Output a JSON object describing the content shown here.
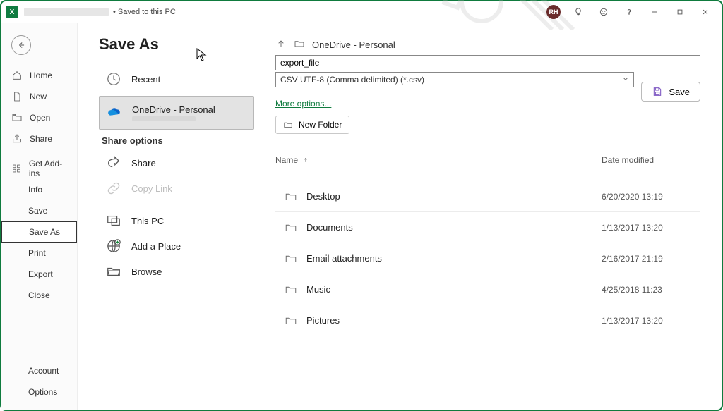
{
  "titlebar": {
    "saved_text": "• Saved to this PC",
    "account_initials": "RH"
  },
  "nav": {
    "home": "Home",
    "new": "New",
    "open": "Open",
    "share": "Share",
    "get_addins": "Get Add-ins",
    "info": "Info",
    "save": "Save",
    "save_as": "Save As",
    "print": "Print",
    "export": "Export",
    "close": "Close",
    "account": "Account",
    "options": "Options"
  },
  "page": {
    "title": "Save As",
    "locations": {
      "recent": "Recent",
      "onedrive": "OneDrive - Personal",
      "this_pc": "This PC",
      "add_place": "Add a Place",
      "browse": "Browse"
    },
    "share_options_label": "Share options",
    "share": "Share",
    "copy_link": "Copy Link"
  },
  "saveas": {
    "current_location": "OneDrive - Personal",
    "filename": "export_file",
    "filetype": "CSV UTF-8 (Comma delimited) (*.csv)",
    "save_button": "Save",
    "more_options": "More options...",
    "new_folder_button": "New Folder",
    "columns": {
      "name": "Name",
      "date": "Date modified"
    }
  },
  "folders": [
    {
      "name": "Desktop",
      "date": "6/20/2020 13:19"
    },
    {
      "name": "Documents",
      "date": "1/13/2017 13:20"
    },
    {
      "name": "Email attachments",
      "date": "2/16/2017 21:19"
    },
    {
      "name": "Music",
      "date": "4/25/2018 11:23"
    },
    {
      "name": "Pictures",
      "date": "1/13/2017 13:20"
    }
  ]
}
